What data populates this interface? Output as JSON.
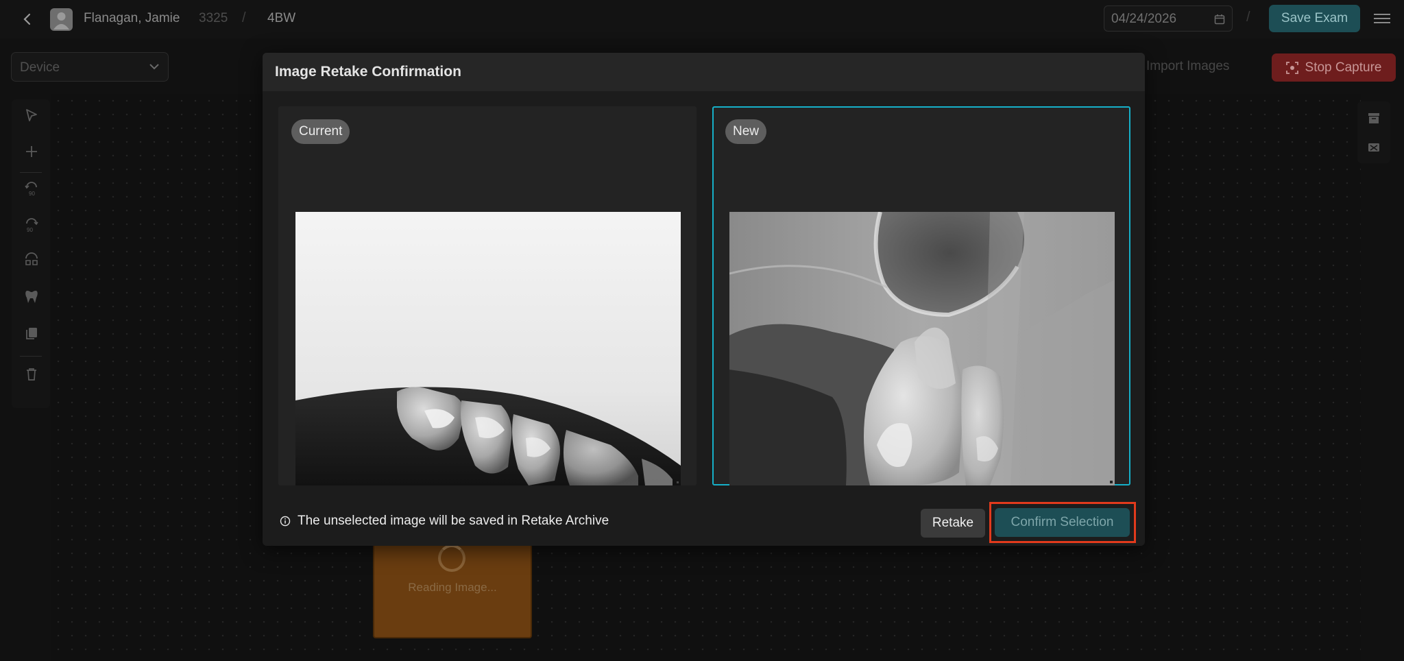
{
  "header": {
    "patient_name": "Flanagan, Jamie",
    "patient_id": "3325",
    "separator": "/",
    "exam_type": "4BW",
    "date": "04/24/2026",
    "save_label": "Save Exam",
    "accent_color": "#1d4e55"
  },
  "toolbar": {
    "device_placeholder": "Device",
    "import_label": "Import Images",
    "stop_capture_label": "Stop Capture",
    "stop_color": "#6e1d1d"
  },
  "tools": {
    "left": [
      "select-icon",
      "add-icon",
      "rotate-ccw-90-icon",
      "rotate-cw-90-icon",
      "flip-icon",
      "tooth-icon",
      "copy-icon",
      "trash-icon"
    ],
    "right": [
      "archive-icon",
      "image-off-icon"
    ]
  },
  "canvas": {
    "reading_text": "Reading Image..."
  },
  "modal": {
    "title": "Image Retake Confirmation",
    "current_label": "Current",
    "new_label": "New",
    "selected": "New",
    "info_text": "The unselected image will be saved in Retake Archive",
    "retake_label": "Retake",
    "confirm_label": "Confirm Selection",
    "selection_color": "#16b0c8",
    "highlight_color": "#e23a1c"
  }
}
